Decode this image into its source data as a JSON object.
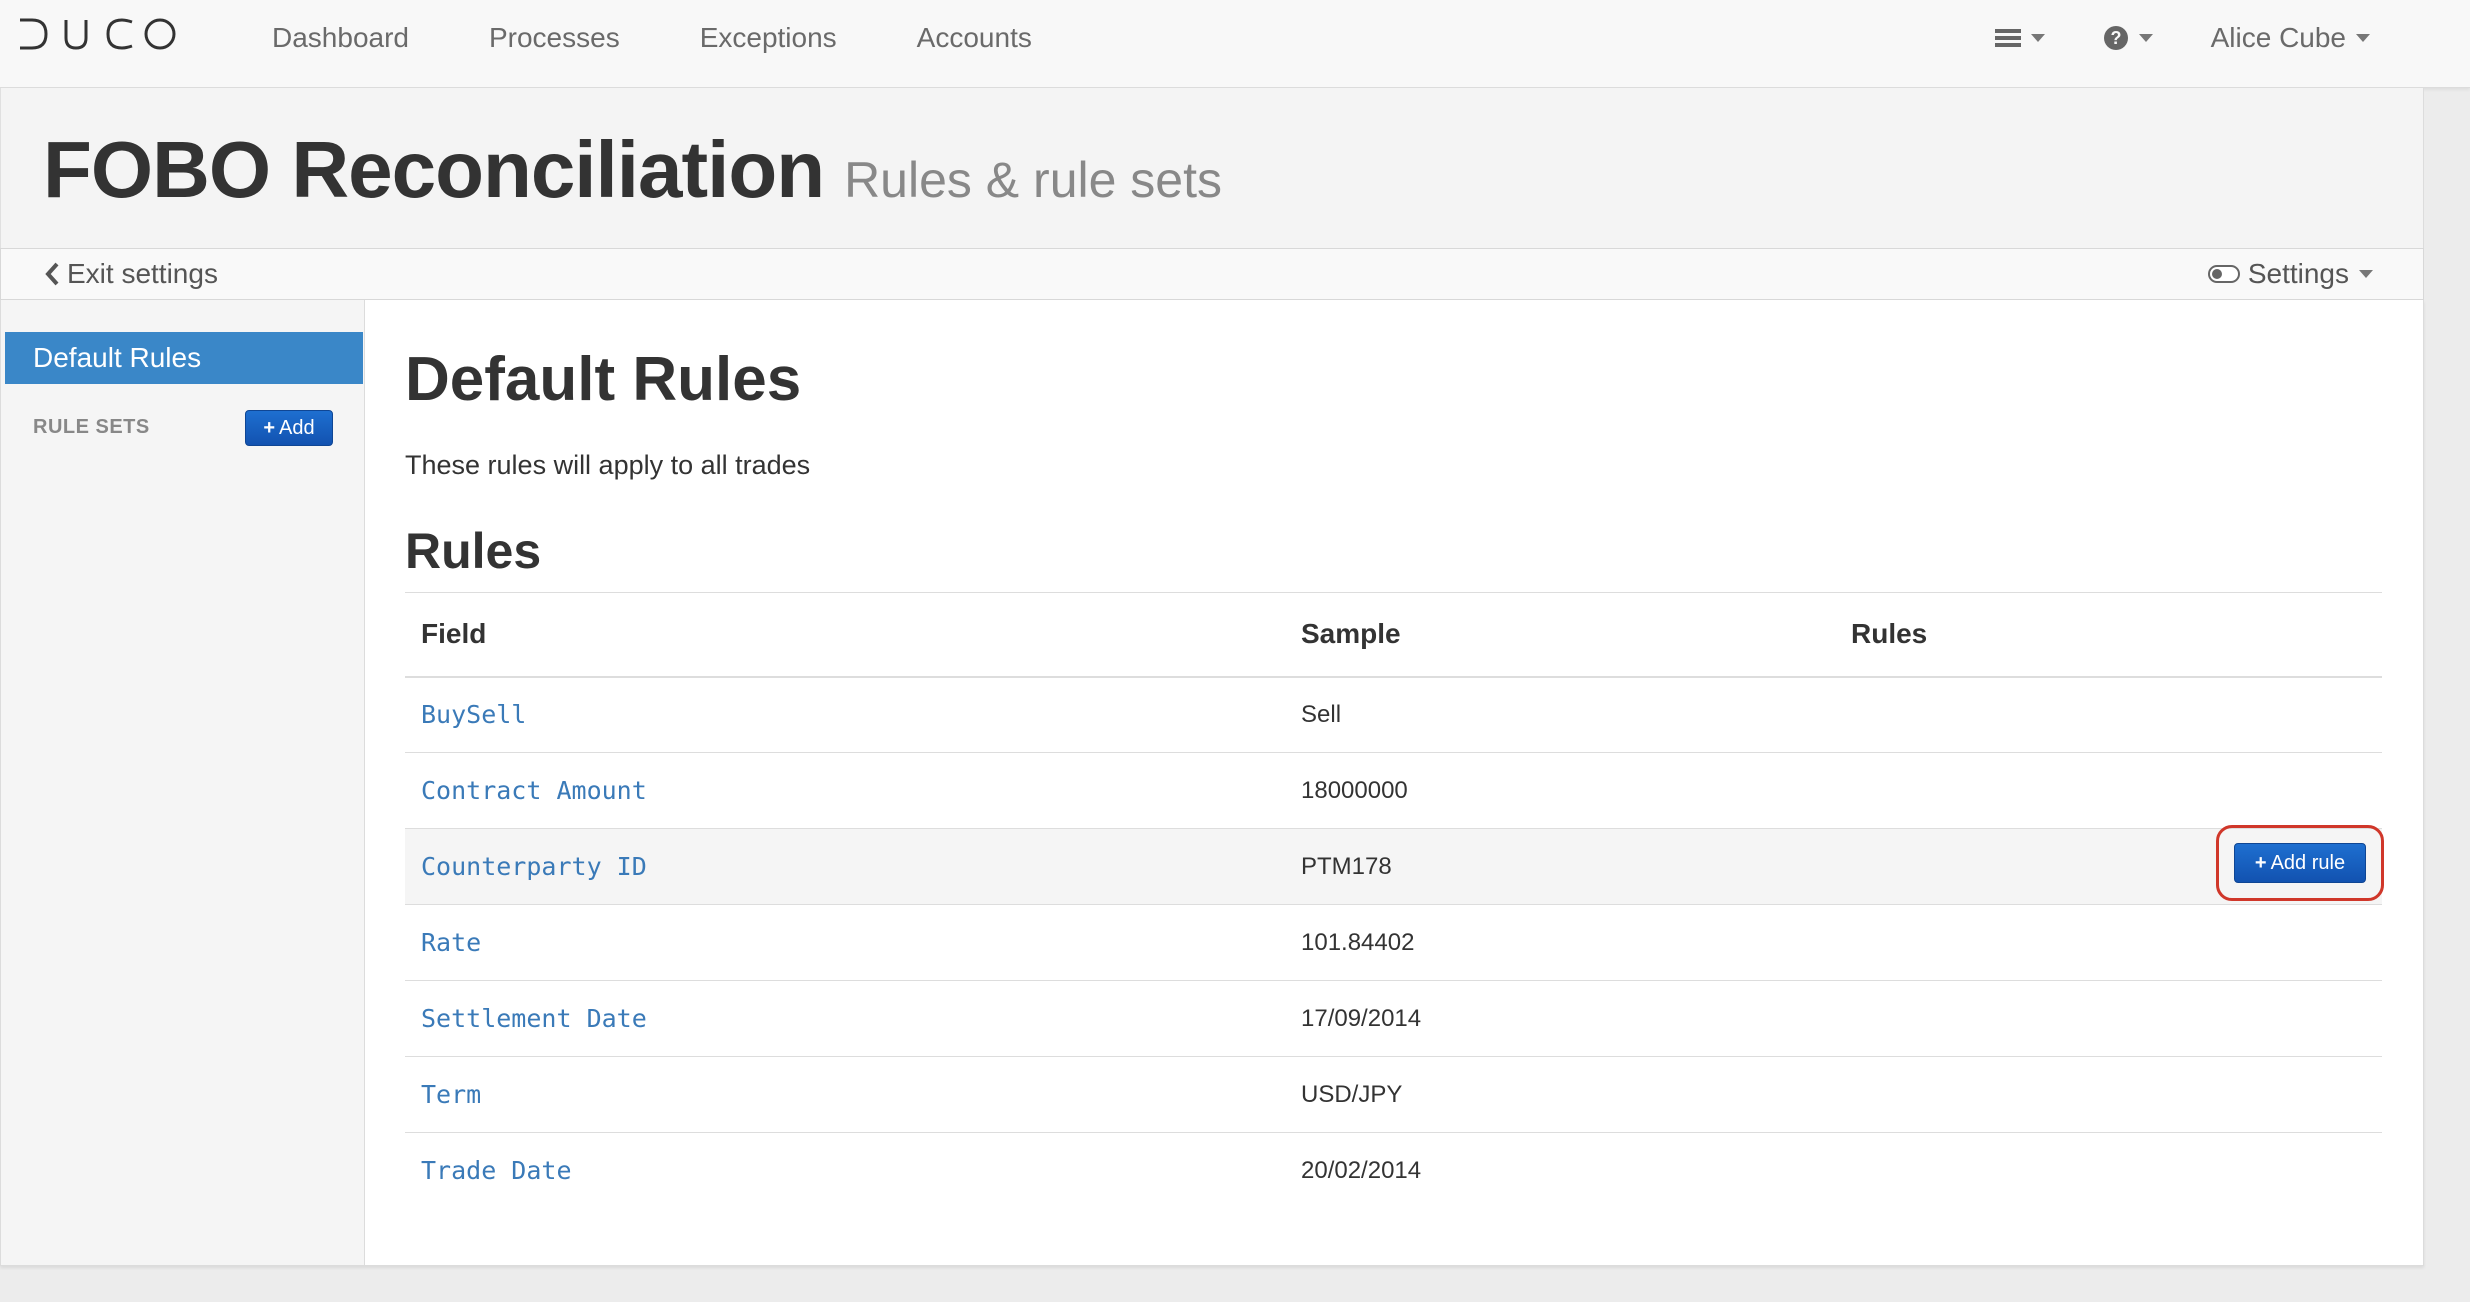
{
  "brand": {
    "logo_text": "DUCO"
  },
  "nav": {
    "links": [
      "Dashboard",
      "Processes",
      "Exceptions",
      "Accounts"
    ],
    "menu_icon": "hamburger-icon",
    "help_icon": "question-circle-icon",
    "user": "Alice Cube"
  },
  "header": {
    "title": "FOBO Reconciliation",
    "subtitle": "Rules & rule sets"
  },
  "settings_bar": {
    "exit_label": "Exit settings",
    "settings_label": "Settings"
  },
  "sidebar": {
    "active_item": "Default Rules",
    "rule_sets_label": "RULE SETS",
    "add_label": "Add"
  },
  "main": {
    "title": "Default Rules",
    "description": "These rules will apply to all trades",
    "rules_heading": "Rules",
    "table": {
      "headers": [
        "Field",
        "Sample",
        "Rules"
      ],
      "rows": [
        {
          "field": "BuySell",
          "sample": "Sell"
        },
        {
          "field": "Contract Amount",
          "sample": "18000000"
        },
        {
          "field": "Counterparty ID",
          "sample": "PTM178",
          "action": "Add rule"
        },
        {
          "field": "Rate",
          "sample": "101.84402"
        },
        {
          "field": "Settlement Date",
          "sample": "17/09/2014"
        },
        {
          "field": "Term",
          "sample": "USD/JPY"
        },
        {
          "field": "Trade Date",
          "sample": "20/02/2014"
        }
      ]
    }
  },
  "colors": {
    "accent_blue": "#3a87c8",
    "button_blue": "#1560c4",
    "link_blue": "#3a7ab8",
    "highlight_red": "#d0372a"
  }
}
